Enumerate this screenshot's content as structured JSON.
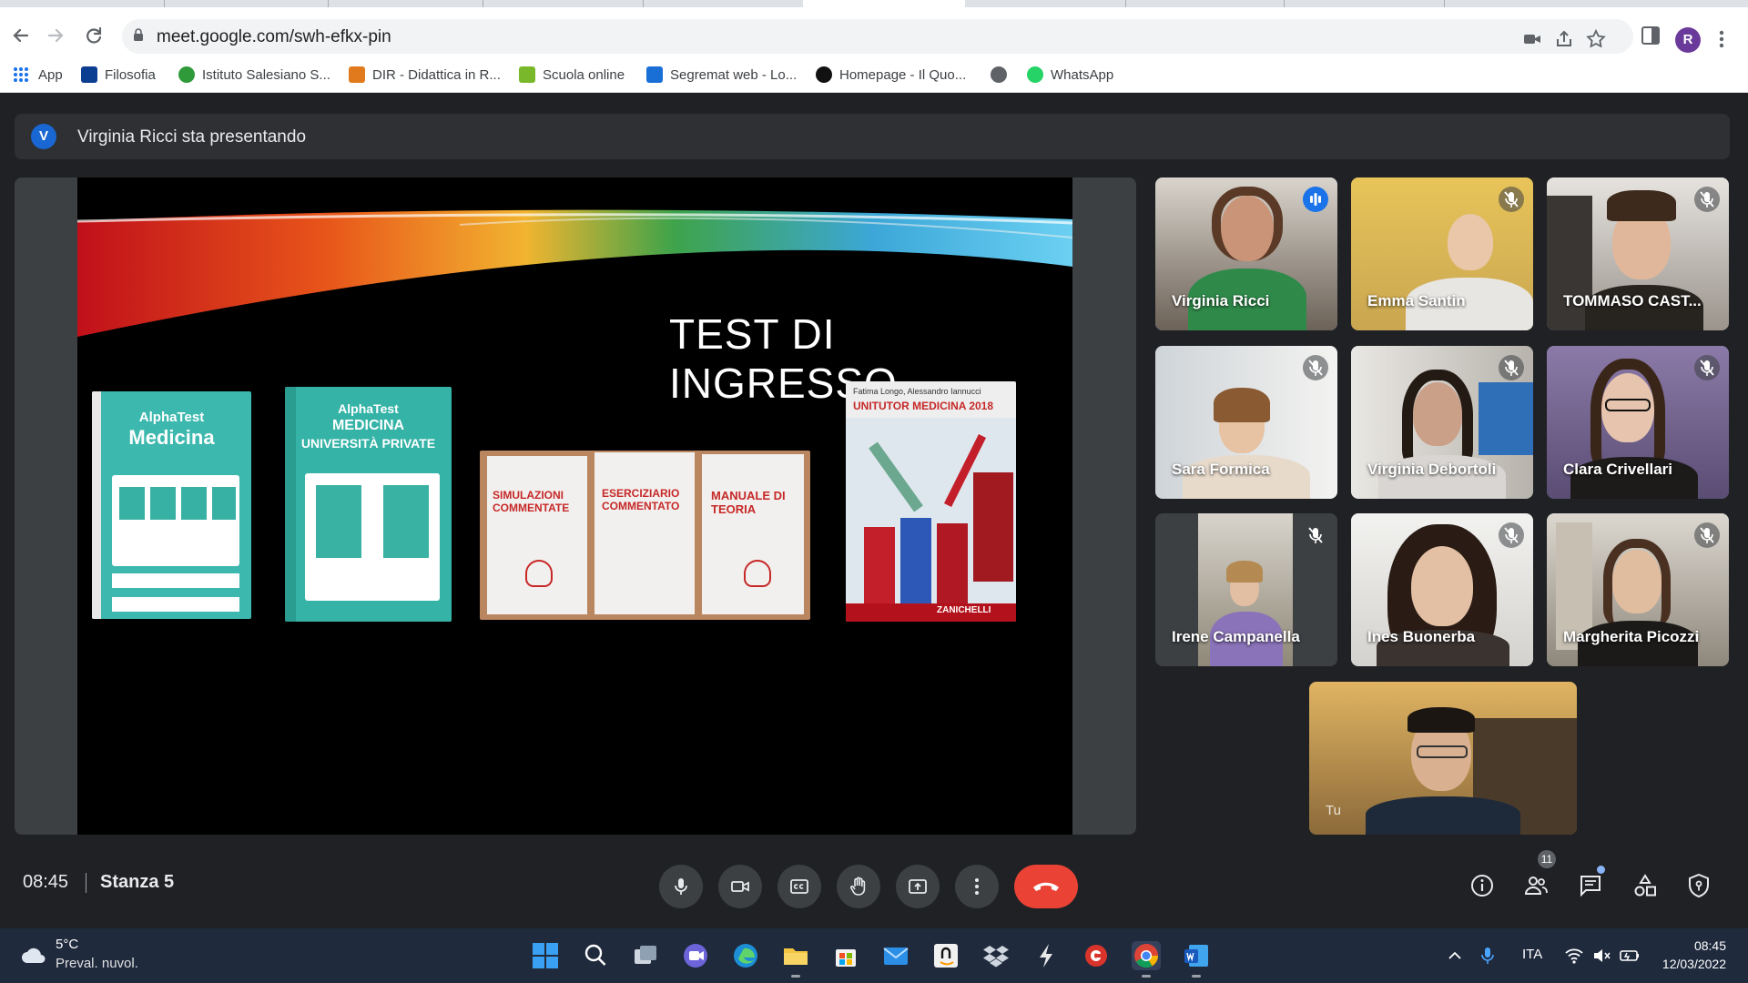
{
  "browser": {
    "url": "meet.google.com/swh-efkx-pin",
    "profile_initial": "R",
    "bookmarks": [
      "App",
      "Filosofia",
      "Istituto Salesiano S...",
      "DIR - Didattica in R...",
      "Scuola online",
      "Segremat web - Lo...",
      "Homepage - Il Quo...",
      "",
      "WhatsApp"
    ]
  },
  "meet": {
    "presenter_initial": "V",
    "presenter_text": "Virginia Ricci sta presentando",
    "slide_title": "TEST DI INGRESSO",
    "books": {
      "b1_line1": "AlphaTest",
      "b1_line2": "Medicina",
      "b2_line1": "AlphaTest",
      "b2_line2": "MEDICINA",
      "b2_line3": "UNIVERSITÀ PRIVATE",
      "b3_a": "SIMULAZIONI COMMENTATE",
      "b3_b": "ESERCIZIARIO COMMENTATO",
      "b3_c": "MANUALE DI TEORIA",
      "b4_authors": "Fatima Longo, Alessandro Iannucci",
      "b4_title": "UNITUTOR MEDICINA 2018",
      "b4_publisher": "ZANICHELLI"
    },
    "participants": [
      {
        "name": "Virginia Ricci",
        "state": "speaking"
      },
      {
        "name": "Emma Santin",
        "state": "muted"
      },
      {
        "name": "TOMMASO CAST...",
        "state": "muted"
      },
      {
        "name": "Sara Formica",
        "state": "muted"
      },
      {
        "name": "Virginia Debortoli",
        "state": "muted"
      },
      {
        "name": "Clara Crivellari",
        "state": "muted"
      },
      {
        "name": "Irene Campanella",
        "state": "muted"
      },
      {
        "name": "Ines Buonerba",
        "state": "muted"
      },
      {
        "name": "Margherita Picozzi",
        "state": "muted"
      },
      {
        "name": "Tu",
        "state": "self"
      }
    ],
    "time": "08:45",
    "room": "Stanza 5",
    "participant_count": "11"
  },
  "taskbar": {
    "temperature": "5°C",
    "weather": "Preval. nuvol.",
    "language": "ITA",
    "clock_time": "08:45",
    "clock_date": "12/03/2022"
  },
  "colors": {
    "meet_bg": "#202124",
    "hangup": "#ea4335",
    "accent": "#1a73e8",
    "taskbar": "#1f2a3d"
  }
}
